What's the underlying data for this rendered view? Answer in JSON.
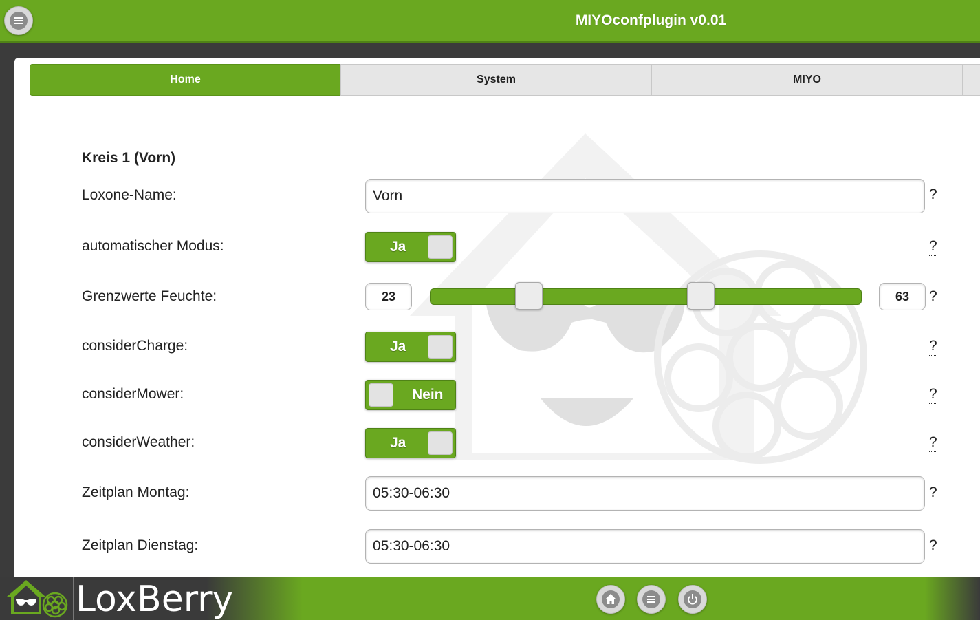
{
  "header": {
    "title": "MIYOconfplugin v0.01",
    "menu_icon": "menu-icon"
  },
  "tabs": [
    {
      "label": "Home",
      "active": true
    },
    {
      "label": "System",
      "active": false
    },
    {
      "label": "MIYO",
      "active": false
    }
  ],
  "form": {
    "section_title": "Kreis 1 (Vorn)",
    "help": "?",
    "loxone_name": {
      "label": "Loxone-Name:",
      "value": "Vorn"
    },
    "auto_mode": {
      "label": "automatischer Modus:",
      "state": "Ja"
    },
    "humidity": {
      "label": "Grenzwerte Feuchte:",
      "min": "23",
      "max": "63"
    },
    "consider_charge": {
      "label": "considerCharge:",
      "state": "Ja"
    },
    "consider_mower": {
      "label": "considerMower:",
      "state": "Nein"
    },
    "consider_weather": {
      "label": "considerWeather:",
      "state": "Ja"
    },
    "schedule_monday": {
      "label": "Zeitplan Montag:",
      "value": "05:30-06:30"
    },
    "schedule_tuesday": {
      "label": "Zeitplan Dienstag:",
      "value": "05:30-06:30"
    }
  },
  "footer": {
    "brand": "LoxBerry",
    "buttons": [
      "home-icon",
      "menu-icon",
      "power-icon"
    ]
  },
  "colors": {
    "accent": "#6aa820",
    "dark": "#3b3b3b"
  }
}
